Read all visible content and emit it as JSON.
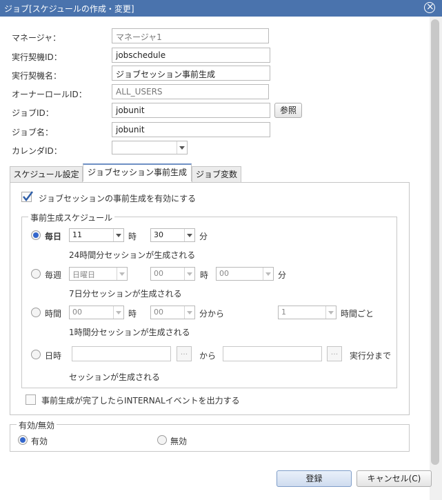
{
  "window": {
    "title": "ジョブ[スケジュールの作成・変更]",
    "close_icon": "close-icon"
  },
  "form": {
    "manager_label": "マネージャ：",
    "manager_value": "マネージャ1",
    "schedule_id_label": "実行契機ID：",
    "schedule_id_value": "jobschedule",
    "schedule_name_label": "実行契機名：",
    "schedule_name_value": "ジョブセッション事前生成",
    "owner_role_label": "オーナーロールID：",
    "owner_role_value": "ALL_USERS",
    "job_id_label": "ジョブID：",
    "job_id_value": "jobunit",
    "browse_button": "参照",
    "job_name_label": "ジョブ名：",
    "job_name_value": "jobunit",
    "calendar_label": "カレンダID：",
    "calendar_value": ""
  },
  "tabs": [
    {
      "label": "スケジュール設定",
      "active": false
    },
    {
      "label": "ジョブセッション事前生成",
      "active": true
    },
    {
      "label": "ジョブ変数",
      "active": false
    }
  ],
  "pregen": {
    "enable_label": "ジョブセッションの事前生成を有効にする",
    "enable_checked": true,
    "group_title": "事前生成スケジュール",
    "daily": {
      "label": "毎日",
      "selected": true,
      "hour": "11",
      "hour_unit": "時",
      "minute": "30",
      "minute_unit": "分",
      "note": "24時間分セッションが生成される"
    },
    "weekly": {
      "label": "毎週",
      "selected": false,
      "day": "日曜日",
      "hour": "00",
      "hour_unit": "時",
      "minute": "00",
      "minute_unit": "分",
      "note": "7日分セッションが生成される"
    },
    "hourly": {
      "label": "時間",
      "selected": false,
      "hour": "00",
      "hour_unit": "時",
      "minute": "00",
      "minute_suffix": "分から",
      "interval": "1",
      "interval_suffix": "時間ごと",
      "note": "1時間分セッションが生成される"
    },
    "datetime": {
      "label": "日時",
      "selected": false,
      "from_value": "",
      "from_label": "から",
      "to_value": "",
      "to_suffix": "実行分まで",
      "browse": "...",
      "note": "セッションが生成される"
    },
    "internal_event_label": "事前生成が完了したらINTERNALイベントを出力する",
    "internal_event_checked": false
  },
  "validity": {
    "title": "有効/無効",
    "enabled_label": "有効",
    "disabled_label": "無効",
    "enabled_selected": true
  },
  "footer": {
    "register_button": "登録",
    "cancel_button": "キャンセル(C)"
  },
  "colors": {
    "titlebar": "#4a73ad",
    "accent": "#3366cc"
  }
}
